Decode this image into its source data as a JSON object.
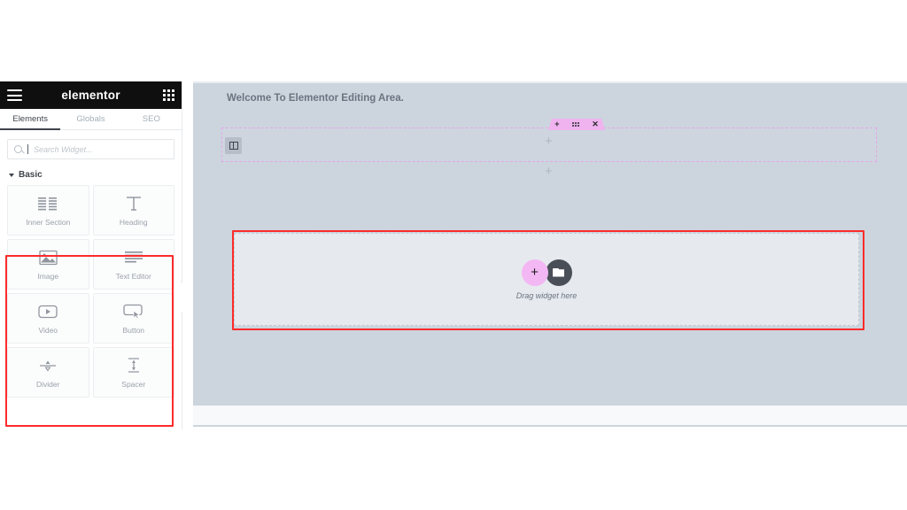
{
  "panel": {
    "header": {
      "menu_icon": "hamburger-icon",
      "brand": "elementor",
      "apps_icon": "grid-apps-icon"
    },
    "tabs": [
      {
        "label": "Elements",
        "active": true
      },
      {
        "label": "Globals",
        "active": false
      },
      {
        "label": "SEO",
        "active": false
      }
    ],
    "search": {
      "placeholder": "Search Widget...",
      "value": "",
      "icon": "search-icon"
    },
    "sections": [
      {
        "title": "Basic",
        "collapse_icon": "caret-down-icon",
        "widgets": [
          {
            "label": "Inner Section",
            "icon": "inner-section-icon",
            "highlighted": false
          },
          {
            "label": "Heading",
            "icon": "heading-text-icon",
            "highlighted": false
          },
          {
            "label": "Image",
            "icon": "image-icon",
            "highlighted": true
          },
          {
            "label": "Text Editor",
            "icon": "text-editor-icon",
            "highlighted": true
          },
          {
            "label": "Video",
            "icon": "video-play-icon",
            "highlighted": true
          },
          {
            "label": "Button",
            "icon": "button-cursor-icon",
            "highlighted": true
          },
          {
            "label": "Divider",
            "icon": "divider-icon",
            "highlighted": true
          },
          {
            "label": "Spacer",
            "icon": "spacer-icon",
            "highlighted": true
          }
        ]
      }
    ],
    "collapse_handle_icon": "chevron-left-icon"
  },
  "canvas": {
    "ghost_text": "",
    "welcome_text": "Welcome To Elementor Editing Area.",
    "section": {
      "column_icon": "column-layout-icon",
      "toolbar": [
        {
          "label": "+",
          "name": "add-section-icon"
        },
        {
          "label": "",
          "name": "drag-section-handle-icon"
        },
        {
          "label": "✕",
          "name": "delete-section-icon"
        }
      ]
    },
    "add_markers": [
      {
        "label": "+"
      },
      {
        "label": "+"
      }
    ],
    "drop_area": {
      "add_button_label": "+",
      "add_button_icon": "add-widget-icon",
      "template_button_icon": "folder-template-icon",
      "hint": "Drag widget here"
    }
  },
  "annotations": {
    "panel_highlight_color": "#fc2b2b",
    "canvas_highlight_color": "#fc2b2b"
  },
  "colors": {
    "panel_header_bg": "#0f0f0f",
    "canvas_bg": "#ccd4de",
    "accent_pink": "#f3b8f3",
    "drop_area_bg": "#e6e9ee"
  }
}
